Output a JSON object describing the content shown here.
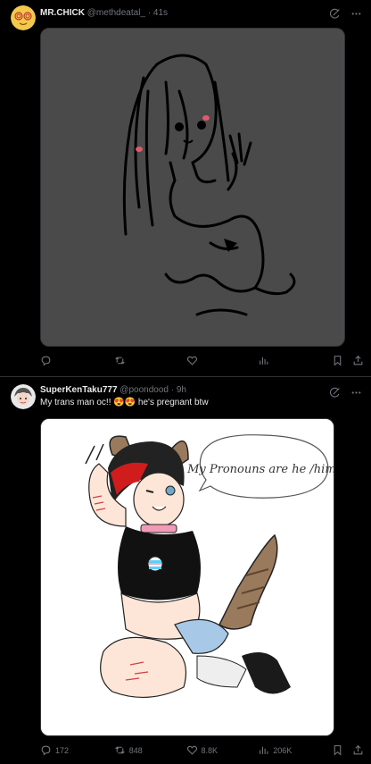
{
  "posts": [
    {
      "author": {
        "name": "MR.CHICK",
        "handle": "@methdeatal_",
        "time": "41s"
      },
      "text": "",
      "actions": {
        "reply": "",
        "retweet": "",
        "like": "",
        "views": ""
      }
    },
    {
      "author": {
        "name": "SuperKenTaku777",
        "handle": "@poondood",
        "time": "9h"
      },
      "text": "My trans man oc!! 😍😍 he's pregnant btw",
      "actions": {
        "reply": "172",
        "retweet": "848",
        "like": "8.8K",
        "views": "206K"
      },
      "image_caption": "My Pronouns are he /him!"
    }
  ],
  "separator": "·",
  "icons": [
    "grok-icon",
    "more-icon",
    "reply-icon",
    "retweet-icon",
    "like-icon",
    "views-icon",
    "bookmark-icon",
    "share-icon"
  ],
  "colors": {
    "background": "#000000",
    "text": "#e7e9ea",
    "secondary": "#71767b",
    "divider": "#2f3336"
  }
}
